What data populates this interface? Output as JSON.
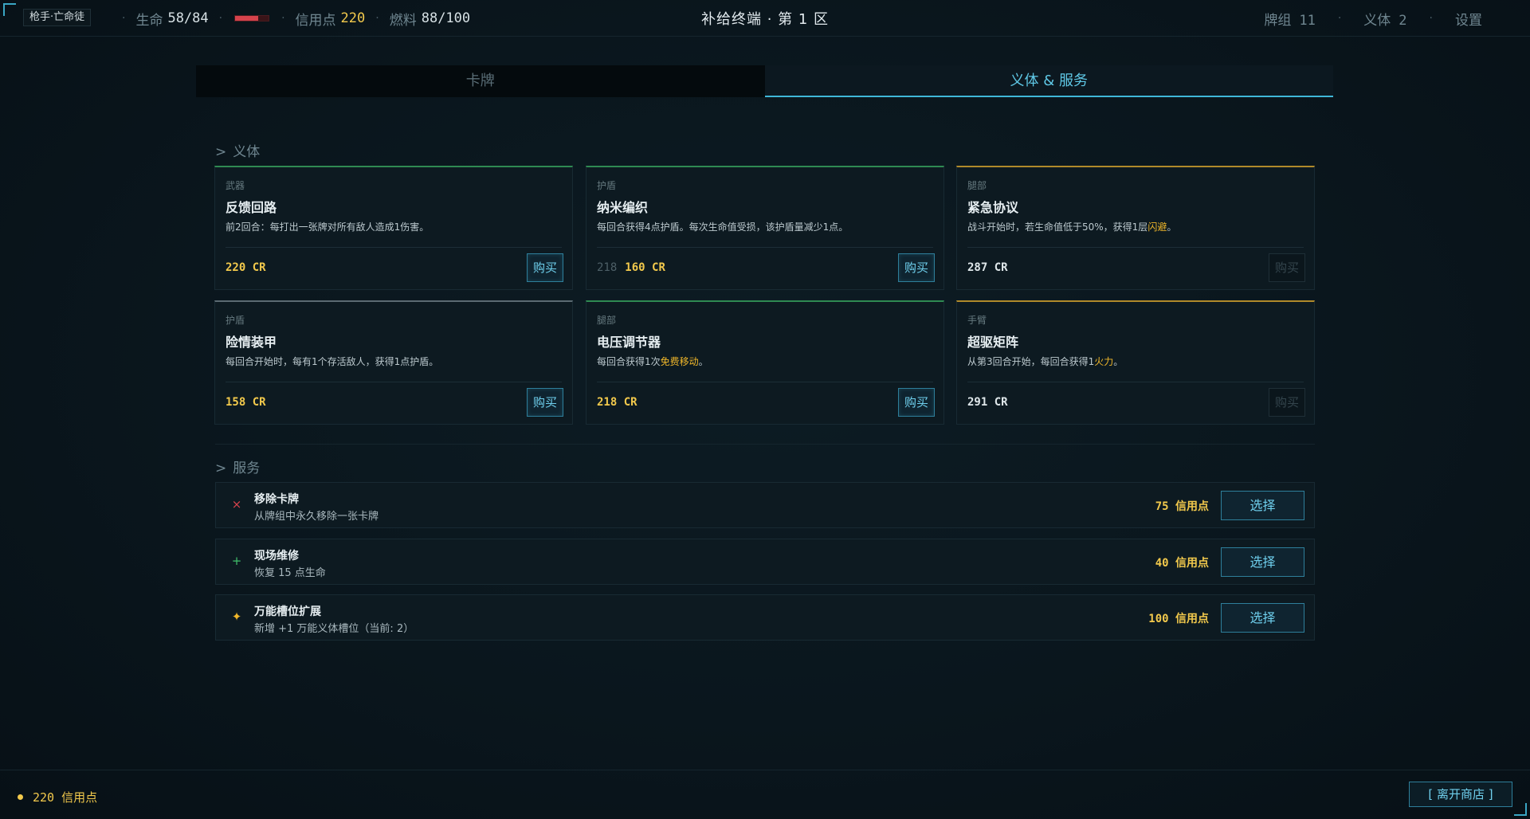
{
  "header": {
    "character": "枪手·亡命徒",
    "hp_label": "生命",
    "hp_value": "58/84",
    "hp_fraction": 0.69,
    "credits_label": "信用点",
    "credits_value": "220",
    "fuel_label": "燃料",
    "fuel_value": "88/100",
    "location": "补给终端 · 第 1 区",
    "deck_label": "牌组",
    "deck_count": "11",
    "implant_label": "义体",
    "implant_count": "2",
    "settings_label": "设置"
  },
  "tabs": [
    {
      "label": "卡牌",
      "active": false
    },
    {
      "label": "义体 & 服务",
      "active": true
    }
  ],
  "implants_section": {
    "prefix": ">",
    "title": "义体",
    "items": [
      {
        "category": "武器",
        "name": "反馈回路",
        "desc": "前2回合：每打出一张牌对所有敌人造成1伤害。",
        "price_old": "",
        "price": "220 CR",
        "buy_label": "购买",
        "affordable": true
      },
      {
        "category": "护盾",
        "name": "纳米编织",
        "desc": "每回合获得4点护盾。每次生命值受损，该护盾量减少1点。",
        "price_old": "218",
        "price": "160 CR",
        "buy_label": "购买",
        "affordable": true
      },
      {
        "category": "腿部",
        "name": "紧急协议",
        "desc_pre": "战斗开始时，若生命值低于50%，获得1层",
        "desc_hl": "闪避",
        "desc_post": "。",
        "price": "287 CR",
        "buy_label": "购买",
        "affordable": false
      },
      {
        "category": "护盾",
        "name": "险情装甲",
        "desc": "每回合开始时，每有1个存活敌人，获得1点护盾。",
        "price": "158 CR",
        "buy_label": "购买",
        "affordable": true
      },
      {
        "category": "腿部",
        "name": "电压调节器",
        "desc_pre": "每回合获得1次",
        "desc_hl": "免费移动",
        "desc_post": "。",
        "price": "218 CR",
        "buy_label": "购买",
        "affordable": true
      },
      {
        "category": "手臂",
        "name": "超驱矩阵",
        "desc_pre": "从第3回合开始，每回合获得1",
        "desc_hl": "火力",
        "desc_post": "。",
        "price": "291 CR",
        "buy_label": "购买",
        "affordable": false
      }
    ]
  },
  "services_section": {
    "prefix": ">",
    "title": "服务",
    "items": [
      {
        "icon": "×",
        "icon_name": "remove-icon",
        "name": "移除卡牌",
        "desc": "从牌组中永久移除一张卡牌",
        "cost": "75 信用点",
        "button": "选择"
      },
      {
        "icon": "+",
        "icon_name": "plus-icon",
        "name": "现场维修",
        "desc": "恢复 15 点生命",
        "cost": "40 信用点",
        "button": "选择"
      },
      {
        "icon": "✦",
        "icon_name": "star-icon",
        "name": "万能槽位扩展",
        "desc": "新增 +1 万能义体槽位（当前: 2）",
        "cost": "100 信用点",
        "button": "选择"
      }
    ]
  },
  "footer": {
    "credits": "220 信用点",
    "leave_label": "[ 离开商店 ]"
  },
  "colors": {
    "accent": "#3fb7d8",
    "gold": "#f2c94c",
    "hp_red": "#d6434c",
    "green_border": "#2f8a52",
    "gold_border": "#b08a2a"
  }
}
